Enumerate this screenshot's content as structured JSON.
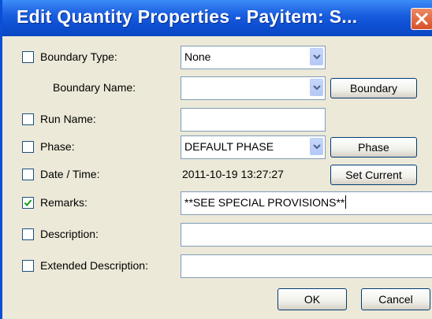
{
  "dialog": {
    "title": "Edit Quantity Properties - Payitem: S...",
    "close_icon": "close-icon"
  },
  "rows": {
    "boundary_type": {
      "label": "Boundary Type:",
      "checked": false,
      "value": "None"
    },
    "boundary_name": {
      "label": "Boundary Name:",
      "value": "",
      "button": "Boundary"
    },
    "run_name": {
      "label": "Run Name:",
      "checked": false,
      "value": ""
    },
    "phase": {
      "label": "Phase:",
      "checked": false,
      "value": "DEFAULT PHASE",
      "button": "Phase"
    },
    "date_time": {
      "label": "Date / Time:",
      "checked": false,
      "value": "2011-10-19 13:27:27",
      "button": "Set Current"
    },
    "remarks": {
      "label": "Remarks:",
      "checked": true,
      "value": "**SEE SPECIAL PROVISIONS**"
    },
    "description": {
      "label": "Description:",
      "checked": false,
      "value": ""
    },
    "extended_description": {
      "label": "Extended Description:",
      "checked": false,
      "value": ""
    }
  },
  "buttons": {
    "ok": "OK",
    "cancel": "Cancel"
  },
  "colors": {
    "title_bar": "#0a4fd6",
    "dialog_bg": "#ece9d8",
    "close": "#d8502a",
    "check": "#21a121"
  }
}
